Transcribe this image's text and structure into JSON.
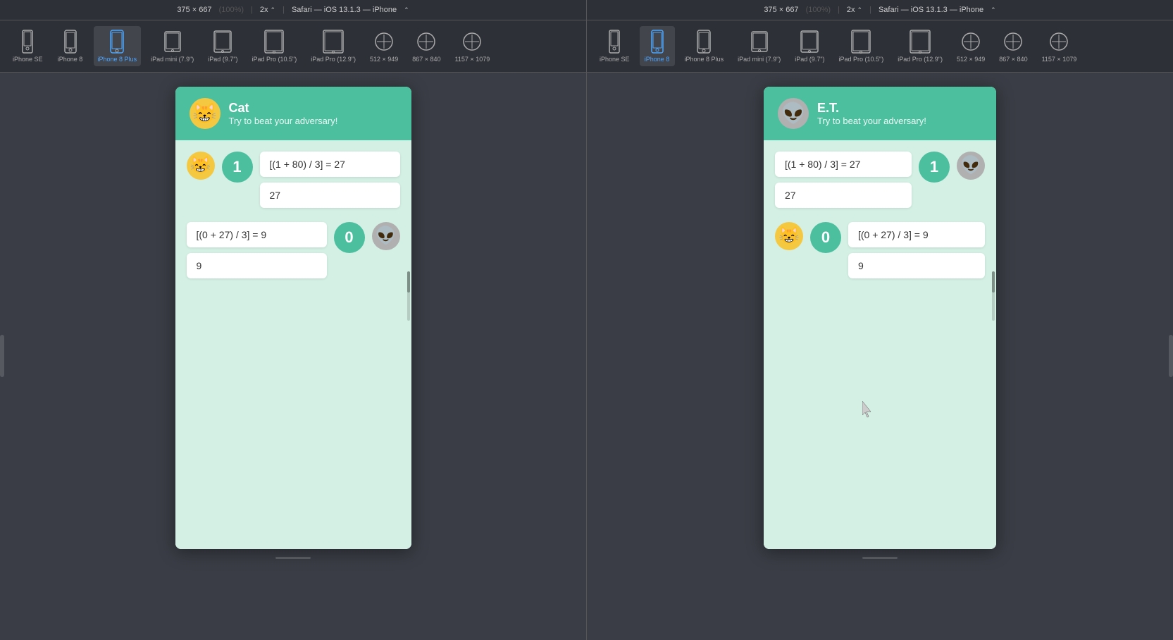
{
  "panels": [
    {
      "id": "left",
      "topbar": {
        "dimensions": "375 × 667",
        "zoom": "100%",
        "scale": "2x",
        "browser": "Safari — iOS 13.1.3 — iPhone"
      },
      "deviceToolbar": {
        "devices": [
          {
            "id": "iphone-se",
            "label": "iPhone SE",
            "type": "phone-small",
            "active": false
          },
          {
            "id": "iphone-8",
            "label": "iPhone 8",
            "type": "phone",
            "active": false
          },
          {
            "id": "iphone-8-plus",
            "label": "iPhone 8 Plus",
            "type": "phone-plus",
            "active": true
          },
          {
            "id": "ipad-mini",
            "label": "iPad mini (7.9\")",
            "type": "tablet",
            "active": false
          },
          {
            "id": "ipad",
            "label": "iPad (9.7\")",
            "type": "tablet",
            "active": false
          },
          {
            "id": "ipad-pro-105",
            "label": "iPad Pro (10.5\")",
            "type": "tablet-wide",
            "active": false
          },
          {
            "id": "ipad-pro-129",
            "label": "iPad Pro (12.9\")",
            "type": "tablet-wide",
            "active": false
          },
          {
            "id": "512x949",
            "label": "512 × 949",
            "type": "custom",
            "active": false
          },
          {
            "id": "867x840",
            "label": "867 × 840",
            "type": "custom",
            "active": false
          },
          {
            "id": "1157x1079",
            "label": "1157 × 1079",
            "type": "custom",
            "active": false
          }
        ]
      },
      "app": {
        "headerBg": "#4bbf9e",
        "playerEmoji": "😸",
        "playerName": "Cat",
        "subtitle": "Try to beat your adversary!",
        "player1": {
          "emoji": "😸",
          "score": "1",
          "equation": "[(1 + 80) / 3] = 27",
          "result": "27",
          "side": "left"
        },
        "player2": {
          "emoji": "👽",
          "score": "0",
          "equation": "[(0 + 27) / 3] = 9",
          "result": "9",
          "side": "right"
        }
      }
    },
    {
      "id": "right",
      "topbar": {
        "dimensions": "375 × 667",
        "zoom": "100%",
        "scale": "2x",
        "browser": "Safari — iOS 13.1.3 — iPhone"
      },
      "deviceToolbar": {
        "devices": [
          {
            "id": "iphone-se",
            "label": "iPhone SE",
            "type": "phone-small",
            "active": false
          },
          {
            "id": "iphone-8",
            "label": "iPhone 8",
            "type": "phone",
            "active": true
          },
          {
            "id": "iphone-8-plus",
            "label": "iPhone 8 Plus",
            "type": "phone-plus",
            "active": false
          },
          {
            "id": "ipad-mini",
            "label": "iPad mini (7.9\")",
            "type": "tablet",
            "active": false
          },
          {
            "id": "ipad",
            "label": "iPad (9.7\")",
            "type": "tablet",
            "active": false
          },
          {
            "id": "ipad-pro-105",
            "label": "iPad Pro (10.5\")",
            "type": "tablet-wide",
            "active": false
          },
          {
            "id": "ipad-pro-129",
            "label": "iPad Pro (12.9\")",
            "type": "tablet-wide",
            "active": false
          },
          {
            "id": "512x949",
            "label": "512 × 949",
            "type": "custom",
            "active": false
          },
          {
            "id": "867x840",
            "label": "867 × 840",
            "type": "custom",
            "active": false
          },
          {
            "id": "1157x1079",
            "label": "1157 × 1079",
            "type": "custom",
            "active": false
          }
        ]
      },
      "app": {
        "headerBg": "#4bbf9e",
        "playerEmoji": "👽",
        "playerName": "E.T.",
        "subtitle": "Try to beat your adversary!",
        "player1": {
          "emoji": "👽",
          "score": "1",
          "equation": "[(1 + 80) / 3] = 27",
          "result": "27",
          "side": "right"
        },
        "player2": {
          "emoji": "😸",
          "score": "0",
          "equation": "[(0 + 27) / 3] = 9",
          "result": "9",
          "side": "left"
        }
      }
    }
  ]
}
